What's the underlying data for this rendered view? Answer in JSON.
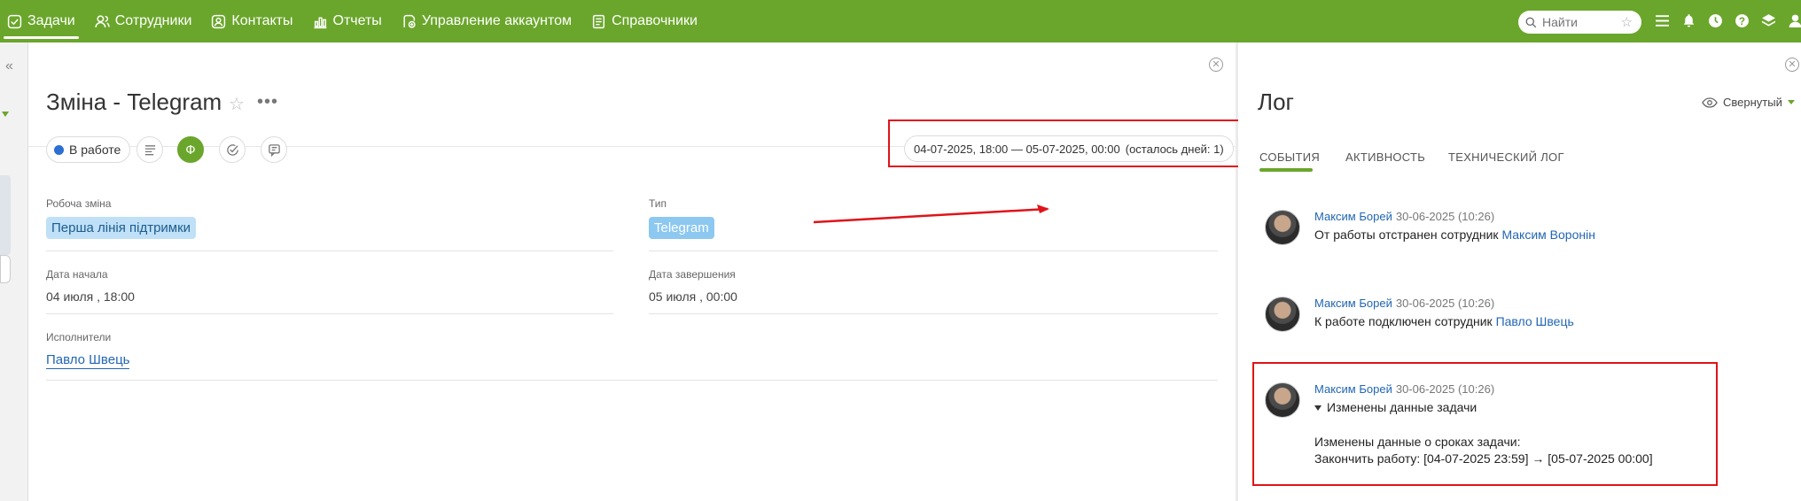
{
  "nav": {
    "items": [
      {
        "label": "Задачи",
        "icon": "tasks-icon"
      },
      {
        "label": "Сотрудники",
        "icon": "users-icon"
      },
      {
        "label": "Контакты",
        "icon": "contacts-icon"
      },
      {
        "label": "Отчеты",
        "icon": "reports-icon"
      },
      {
        "label": "Управление аккаунтом",
        "icon": "account-icon"
      },
      {
        "label": "Справочники",
        "icon": "directory-icon"
      }
    ],
    "search_placeholder": "Найти",
    "icons": [
      "menu-icon",
      "notification-icon",
      "timer-icon",
      "help-icon",
      "layers-icon",
      "profile-icon"
    ]
  },
  "task": {
    "title": "Зміна - Telegram",
    "status": "В работе",
    "action_green": "Ф",
    "date_range": "04-07-2025, 18:00 — 05-07-2025, 00:00",
    "remaining": "(осталось дней: 1)",
    "fields": {
      "shift_label": "Робоча зміна",
      "shift_value": "Перша лінія підтримки",
      "type_label": "Тип",
      "type_value": "Telegram",
      "start_label": "Дата начала",
      "start_value": "04 июля , 18:00",
      "end_label": "Дата завершения",
      "end_value": "05 июля , 00:00",
      "assignees_label": "Исполнители",
      "assignee": "Павло Швець"
    }
  },
  "log": {
    "title": "Лог",
    "view_mode": "Свернутый",
    "tabs": [
      "События",
      "Активность",
      "Технический лог"
    ],
    "entries": [
      {
        "author": "Максим Борей",
        "time": "30-06-2025 (10:26)",
        "text": "От работы отстранен сотрудник ",
        "link": "Максим Воронін"
      },
      {
        "author": "Максим Борей",
        "time": "30-06-2025 (10:26)",
        "text": "К работе подключен сотрудник ",
        "link": "Павло Швець"
      },
      {
        "author": "Максим Борей",
        "time": "30-06-2025 (10:26)",
        "text": "Изменены данные задачи",
        "detail1": "Изменены данные о сроках задачи:",
        "detail2": "Закончить работу: [04-07-2025 23:59] → [05-07-2025 00:00]"
      }
    ]
  },
  "colors": {
    "brand": "#6aa62b",
    "highlight": "#e0131a",
    "link": "#2266b3"
  }
}
